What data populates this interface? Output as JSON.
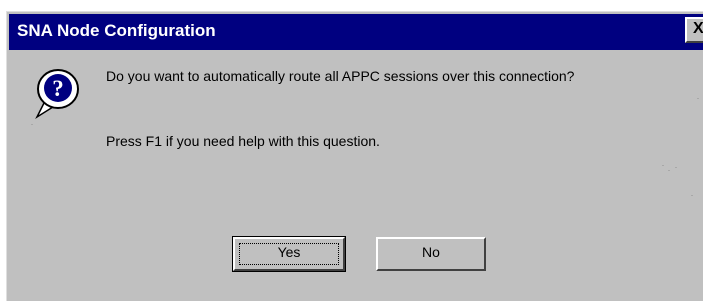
{
  "window": {
    "title": "SNA Node Configuration",
    "close_label": "X"
  },
  "message": {
    "question": "Do you want to automatically route all APPC sessions over this connection?",
    "help_text": "Press F1 if you need help with this question."
  },
  "buttons": {
    "yes_label": "Yes",
    "no_label": "No"
  },
  "icons": {
    "message_icon": "question-icon"
  },
  "colors": {
    "title_bar": "#000080",
    "dialog_background": "#c0c0c0",
    "icon_fill": "#000080"
  }
}
